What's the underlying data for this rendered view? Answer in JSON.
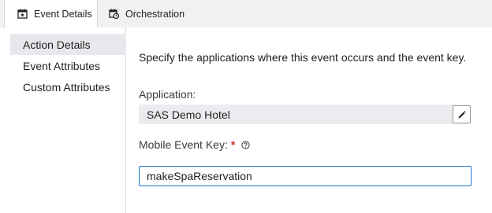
{
  "tabs": [
    {
      "label": "Event Details",
      "icon": "calendar-star-icon",
      "active": true
    },
    {
      "label": "Orchestration",
      "icon": "calendar-clock-icon",
      "active": false
    }
  ],
  "sidebar": {
    "items": [
      {
        "label": "Action Details",
        "selected": true
      },
      {
        "label": "Event Attributes",
        "selected": false
      },
      {
        "label": "Custom Attributes",
        "selected": false
      }
    ]
  },
  "main": {
    "intro": "Specify the applications where this event occurs and the event key.",
    "application": {
      "label": "Application:",
      "value": "SAS Demo Hotel",
      "edit_icon": "pencil-icon"
    },
    "event_key": {
      "label": "Mobile Event Key:",
      "required_marker": "*",
      "help_icon": "help-circle-icon",
      "value": "makeSpaReservation"
    }
  },
  "colors": {
    "accent": "#1d73c9",
    "required": "#d4291f",
    "tabbar_bg": "#f1f1f3",
    "selected_bg": "#e8e8ec"
  }
}
